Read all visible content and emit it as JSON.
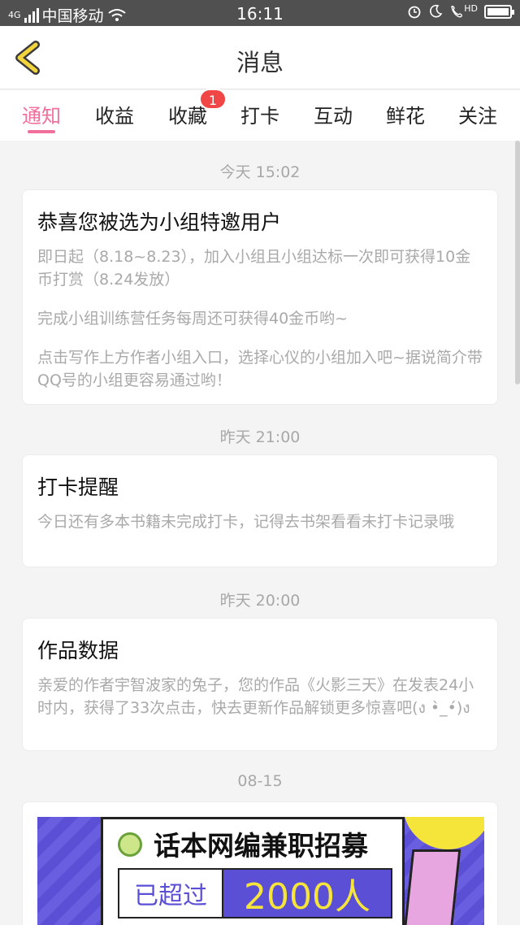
{
  "status_bar": {
    "network_type": "4G",
    "carrier": "中国移动",
    "time": "16:11",
    "hd_label": "HD"
  },
  "header": {
    "title": "消息"
  },
  "tabs": [
    {
      "label": "通知",
      "active": true
    },
    {
      "label": "收益"
    },
    {
      "label": "收藏",
      "badge": "1"
    },
    {
      "label": "打卡"
    },
    {
      "label": "互动"
    },
    {
      "label": "鲜花"
    },
    {
      "label": "关注"
    }
  ],
  "feed": [
    {
      "time": "今天 15:02",
      "title": "恭喜您被选为小组特邀用户",
      "paragraphs": [
        "即日起（8.18~8.23），加入小组且小组达标一次即可获得10金币打赏（8.24发放）",
        "完成小组训练营任务每周还可获得40金币哟~",
        "点击写作上方作者小组入口，选择心仪的小组加入吧~据说简介带QQ号的小组更容易通过哟！"
      ]
    },
    {
      "time": "昨天 21:00",
      "title": "打卡提醒",
      "paragraphs": [
        "今日还有多本书籍未完成打卡，记得去书架看看未打卡记录哦"
      ]
    },
    {
      "time": "昨天 20:00",
      "title": "作品数据",
      "paragraphs": [
        "亲爱的作者宇智波家的兔子，您的作品《火影三天》在发表24小时内，获得了33次点击，快去更新作品解锁更多惊喜吧(ง •̀_•́)ง"
      ]
    },
    {
      "time": "08-15"
    }
  ],
  "banner": {
    "title": "话本网编兼职招募",
    "label": "已超过",
    "number": "2000人"
  },
  "colors": {
    "accent": "#f0709b",
    "badge": "#f04646",
    "banner_purple": "#5b4fd6",
    "banner_yellow": "#f5e43a",
    "back_arrow": "#f2d43d"
  }
}
